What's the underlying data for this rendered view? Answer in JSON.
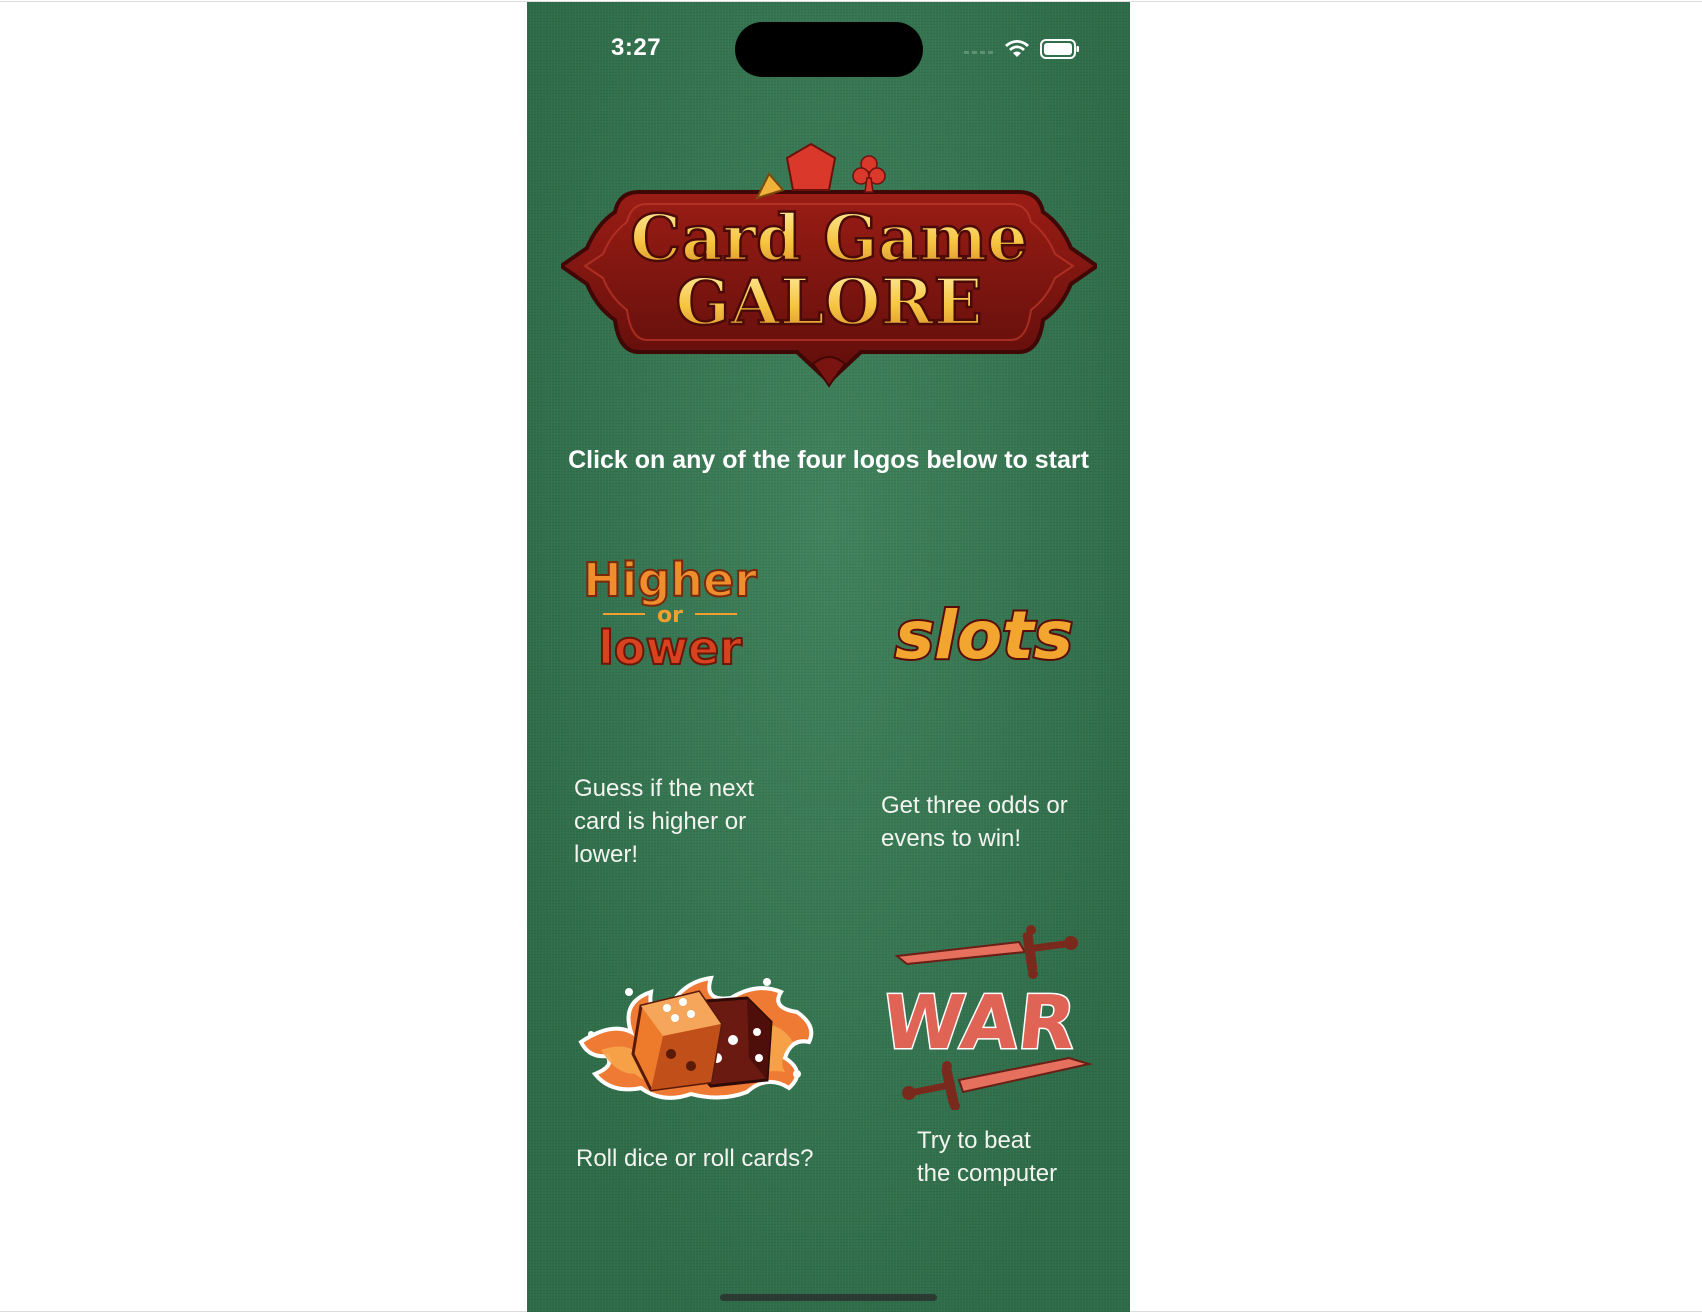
{
  "status_bar": {
    "time": "3:27",
    "icons": [
      "cellular-signal-icon",
      "wifi-icon",
      "battery-icon"
    ]
  },
  "header": {
    "logo_line1": "Card Game",
    "logo_line2": "GALORE",
    "instruction": "Click on any of the four logos below to start"
  },
  "games": [
    {
      "logo_word1": "Higher",
      "logo_word2": "or",
      "logo_word3": "lower",
      "description": "Guess if the next\ncard is higher or\nlower!"
    },
    {
      "logo_word1": "slots",
      "description": "Get three odds or\nevens to win!"
    },
    {
      "logo_icon": "dice-icon",
      "description": "Roll dice or roll cards?"
    },
    {
      "logo_word1": "WAR",
      "description": "Try to beat\nthe computer"
    }
  ],
  "colors": {
    "felt_green": "#347a52",
    "logo_maroon": "#7a1410",
    "logo_gold": "#f6c440",
    "accent_orange": "#e2641c",
    "war_red": "#e06456"
  }
}
